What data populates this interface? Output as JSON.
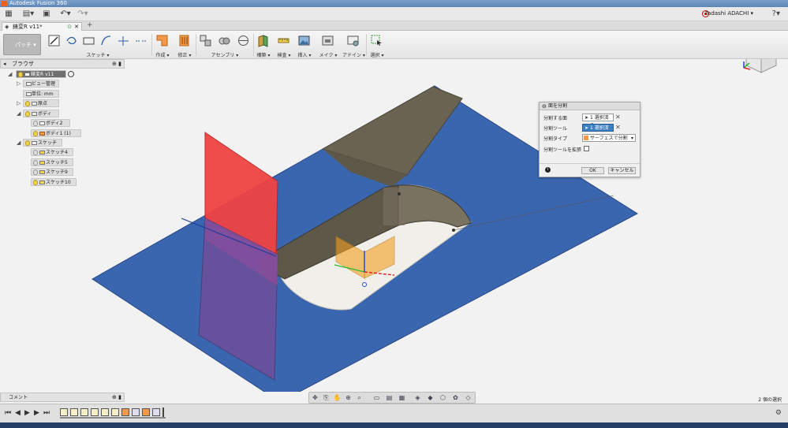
{
  "window": {
    "title": "Autodesk Fusion 360"
  },
  "user": {
    "name": "Tadashi ADACHI ▾"
  },
  "document": {
    "tab_name": "錶変R v11*"
  },
  "workspace": {
    "label": "パッチ ▾"
  },
  "ribbon": {
    "sketch": "スケッチ ▾",
    "create": "作成 ▾",
    "modify": "修正 ▾",
    "assemble": "アセンブリ ▾",
    "construct": "構築 ▾",
    "inspect": "検査 ▾",
    "insert": "挿入 ▾",
    "make": "メイク ▾",
    "addins": "アドイン ▾",
    "select": "選択 ▾"
  },
  "browser": {
    "title": "ブラウザ",
    "root": "錶変R v11",
    "items": {
      "named_views": "ビュー管理",
      "units": "単位: mm",
      "origin": "原点",
      "bodies": "ボディ",
      "body2": "ボディ2",
      "body1": "ボディ1 (1)",
      "sketches": "スケッチ",
      "sketch4": "スケッチ4",
      "sketch5": "スケッチ5",
      "sketch9": "スケッチ9",
      "sketch10": "スケッチ10"
    }
  },
  "dialog": {
    "title": "面を分割",
    "face_to_split_label": "分割する面",
    "face_to_split_value": "1 選択済み",
    "split_tool_label": "分割ツール",
    "split_tool_value": "1 選択済み",
    "split_type_label": "分割タイプ",
    "split_type_value": "サーフェスで分割",
    "extend_tool_label": "分割ツールを拡張",
    "ok": "OK",
    "cancel": "キャンセル"
  },
  "comments": {
    "label": "コメント"
  },
  "status": {
    "selection": "2 個の選択"
  },
  "colors": {
    "plane_blue": "#3a66b0",
    "red_plane": "#ef4444",
    "brown_face": "#6b6351",
    "wall_face": "#5e5849",
    "dialog_selected": "#3c7fc1"
  }
}
